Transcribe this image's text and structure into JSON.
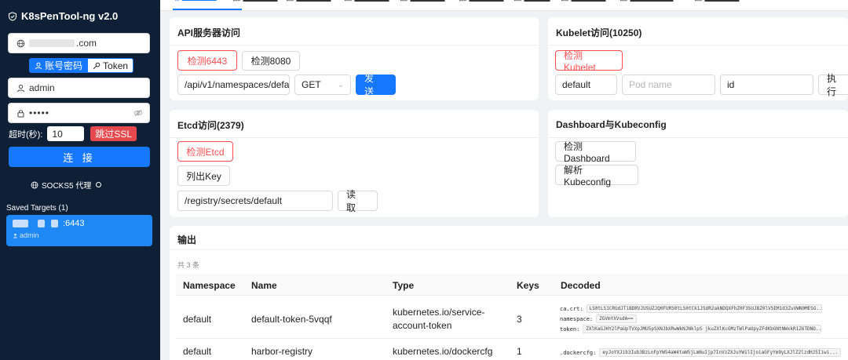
{
  "app": {
    "title": "K8sPenTool-ng v2.0"
  },
  "login": {
    "host_suffix": ".com",
    "tabs": [
      {
        "label": "账号密码"
      },
      {
        "label": "Token"
      }
    ],
    "username": "admin",
    "password_mask": "•••••",
    "timeout_label": "超时(秒):",
    "timeout_value": "10",
    "skip_ssl_label": "跳过SSL",
    "connect_label": "连 接",
    "socks_label": "SOCKS5 代理"
  },
  "saved": {
    "title": "Saved Targets (1)",
    "items": [
      {
        "host_suffix": ":6443",
        "user": "admin"
      }
    ]
  },
  "topnav": {
    "active_index": 0
  },
  "api": {
    "title": "API服务器访问",
    "check6443": "检测6443",
    "check8080": "检测8080",
    "path": "/api/v1/namespaces/defa",
    "method": "GET",
    "send": "发 送"
  },
  "kubelet": {
    "title": "Kubelet访问(10250)",
    "check": "检测Kubelet",
    "namespace": "default",
    "pod_placeholder": "Pod name",
    "id_value": "id",
    "exec": "执 行"
  },
  "etcd": {
    "title": "Etcd访问(2379)",
    "check": "检测Etcd",
    "list_keys": "列出Key",
    "key_path": "/registry/secrets/default",
    "read": "读 取"
  },
  "dashboard": {
    "title": "Dashboard与Kubeconfig",
    "check": "检测Dashboard",
    "parse": "解析Kubeconfig"
  },
  "output": {
    "title": "输出",
    "count": "共 3 条",
    "columns": [
      "Namespace",
      "Name",
      "Type",
      "Keys",
      "Decoded"
    ],
    "rows": [
      {
        "namespace": "default",
        "name": "default-token-5vqqf",
        "type_line1": "kubernetes.io/service-",
        "type_line2": "account-token",
        "keys": "3",
        "decoded": [
          {
            "key": "ca.crt:",
            "value": "LS0tLS1CRUdJTiBDRVJUSUZJQ0FURS0tLS0tCk1JSUR2akNDQXFhZ0F3SUJBZ0lVSEM1d3ZuVWN0MESG..."
          },
          {
            "key": "namespace:",
            "value": "ZGVmYXVsdA=="
          },
          {
            "key": "token:",
            "value": "ZXlKaGJHY2lPaUpTVXpJMU5pSXNJbXRwWkNJNklpS jkuZXlKcGMzTWlPaUpyZFdKbGNtNWxkR1Z6TDNO..."
          }
        ]
      },
      {
        "namespace": "default",
        "name": "harbor-registry",
        "type_line1": "kubernetes.io/dockercfg",
        "keys": "1",
        "decoded": [
          {
            "key": ".dockercfg:",
            "value": "eyJoYXJib3Iub3BzLnFpYW54aW4taW5jLmNuIjp7InVzZXJuYW1lIjoiaGFyYm9yLXJlZ2lzdHJ5Iiwi..."
          }
        ]
      }
    ]
  }
}
